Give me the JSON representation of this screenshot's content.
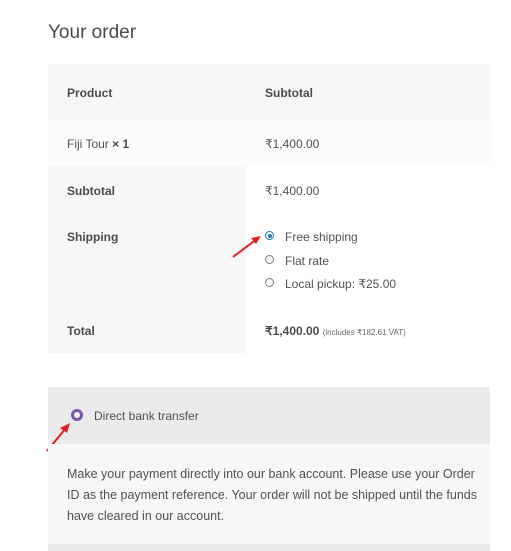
{
  "heading": "Your order",
  "table": {
    "col_product": "Product",
    "col_subtotal": "Subtotal",
    "item": {
      "name": "Fiji Tour",
      "qty": "× 1",
      "price": "₹1,400.00"
    },
    "subtotal_label": "Subtotal",
    "subtotal_value": "₹1,400.00",
    "shipping_label": "Shipping",
    "shipping_options": [
      {
        "label": "Free shipping",
        "selected": true
      },
      {
        "label": "Flat rate",
        "selected": false
      },
      {
        "label": "Local pickup: ₹25.00",
        "selected": false
      }
    ],
    "total_label": "Total",
    "total_value": "₹1,400.00",
    "total_tax_note": "(includes ₹182.61 VAT)"
  },
  "payment": {
    "method_label": "Direct bank transfer",
    "description": "Make your payment directly into our bank account. Please use your Order ID as the payment reference. Your order will not be shipped until the funds have cleared in our account."
  },
  "colors": {
    "accent_radio": "#7f54b3",
    "annotation_arrow": "#e02020"
  }
}
